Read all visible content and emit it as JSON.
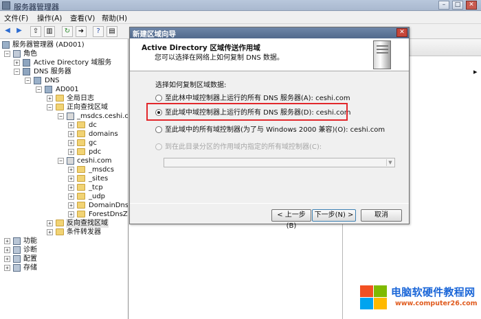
{
  "window": {
    "title": "服务器管理器"
  },
  "menu": [
    "文件(F)",
    "操作(A)",
    "查看(V)",
    "帮助(H)"
  ],
  "tree": {
    "root": "服务器管理器 (AD001)",
    "roles": "角色",
    "ad": "Active Directory 域服务",
    "dns_server": "DNS 服务器",
    "dns": "DNS",
    "ad001": "AD001",
    "global_log": "全局日志",
    "forward_zone": "正向查找区域",
    "msdcs_zone": "_msdcs.ceshi.c",
    "dc": "dc",
    "domains": "domains",
    "gc": "gc",
    "pdc": "pdc",
    "ceshi": "ceshi.com",
    "msdcs": "_msdcs",
    "sites": "_sites",
    "tcp": "_tcp",
    "udp": "_udp",
    "domaindns": "DomainDnsZo",
    "forestdns": "ForestDnsZo",
    "reverse_zone": "反向查找区域",
    "cond_forwarder": "条件转发器",
    "features": "功能",
    "diagnostics": "诊断",
    "config": "配置",
    "storage": "存储"
  },
  "dialog": {
    "title": "新建区域向导",
    "heading": "Active Directory 区域传送作用域",
    "subheading": "您可以选择在网络上如何复制 DNS 数据。",
    "prompt": "选择如何复制区域数据:",
    "options": [
      "至此林中域控制器上运行的所有 DNS 服务器(A): ceshi.com",
      "至此域中域控制器上运行的所有 DNS 服务器(D): ceshi.com",
      "至此域中的所有域控制器(为了与 Windows 2000 兼容)(O): ceshi.com",
      "到在此目录分区的作用域内指定的所有域控制器(C):"
    ],
    "selected_index": 1,
    "back": "< 上一步(B)",
    "next": "下一步(N) >",
    "cancel": "取消"
  },
  "watermark": {
    "text": "电脑软硬件教程网",
    "url": "www.computer26.com"
  },
  "colors": {
    "highlight": "#e2262a",
    "title_blue": "#51698c"
  }
}
